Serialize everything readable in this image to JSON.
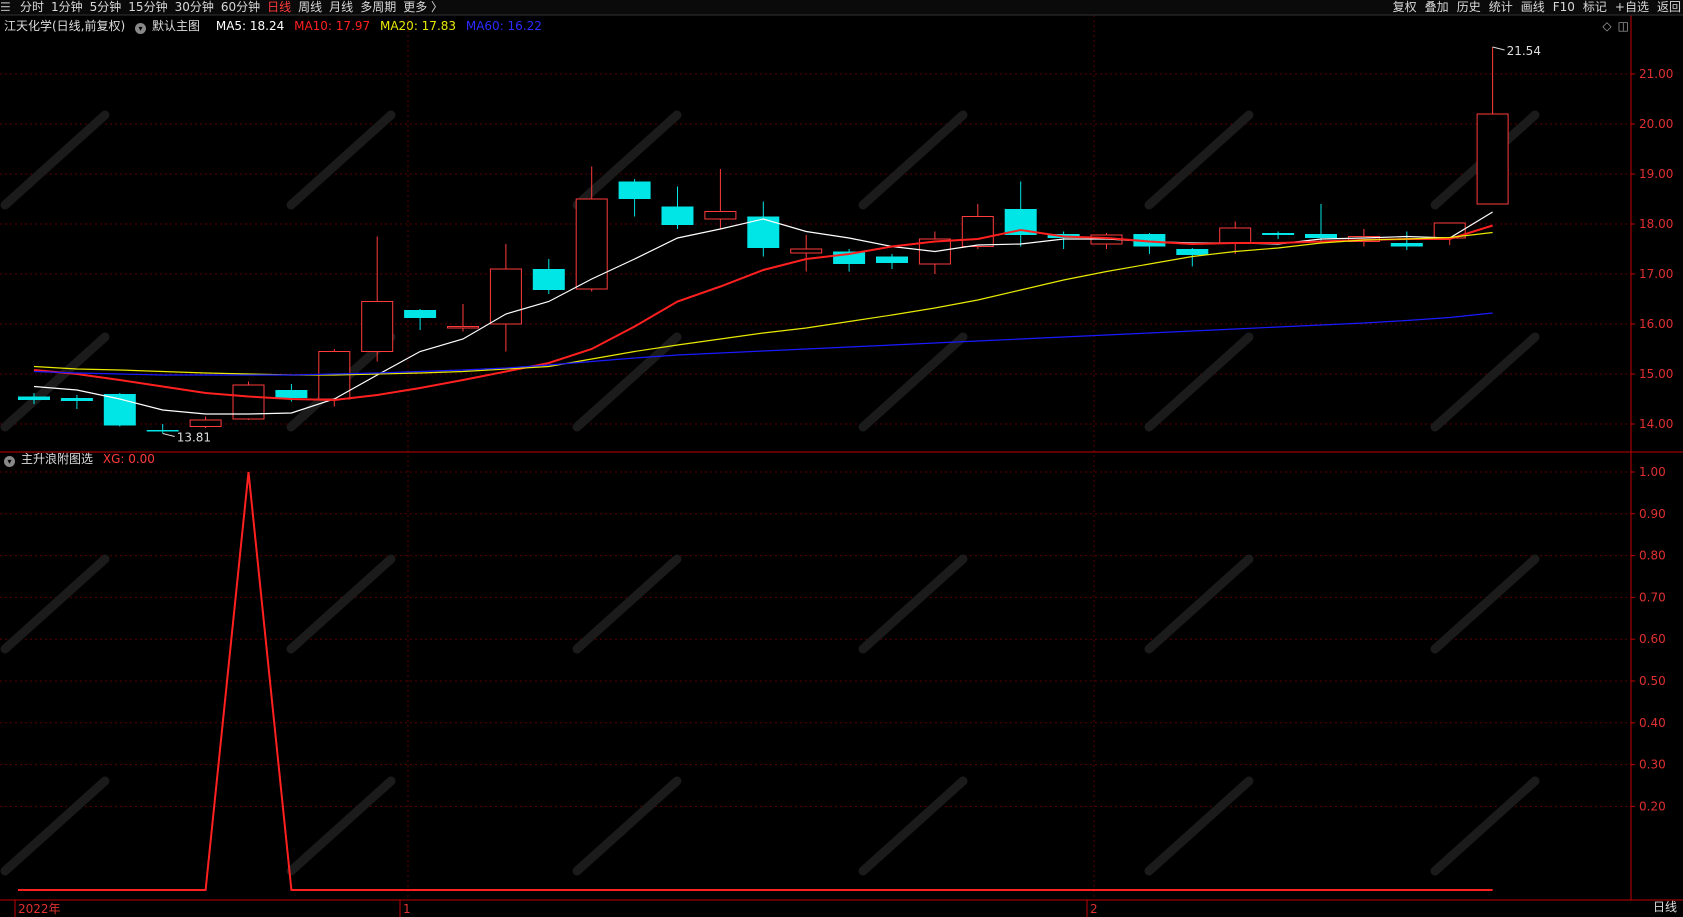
{
  "toolbar": {
    "left_items": [
      "分时",
      "1分钟",
      "5分钟",
      "15分钟",
      "30分钟",
      "60分钟",
      "日线",
      "周线",
      "月线",
      "多周期",
      "更多 〉"
    ],
    "active": "日线",
    "right_items": [
      "复权",
      "叠加",
      "历史",
      "统计",
      "画线",
      "F10",
      "标记",
      "+自选",
      "返回"
    ]
  },
  "main_legend": {
    "title": "江天化学(日线,前复权)",
    "indicator": "默认主图",
    "ma5": "MA5: 18.24",
    "ma10": "MA10: 17.97",
    "ma20": "MA20: 17.83",
    "ma60": "MA60: 16.22"
  },
  "sub_legend": {
    "indicator": "主升浪附图选",
    "xg": "XG: 0.00"
  },
  "bottom": {
    "period_label": "日线",
    "date_labels": [
      "2022年",
      "1",
      "2"
    ]
  },
  "colors": {
    "up": "#ff3b3b",
    "down": "#00e5e5",
    "ma5": "#ffffff",
    "ma10": "#ff2020",
    "ma20": "#e8e800",
    "ma60": "#1a1aff",
    "grid": "#5a0000",
    "axis": "#c00000"
  },
  "chart_data": [
    {
      "type": "candlestick",
      "title": "江天化学(日线,前复权)",
      "ylim": [
        13.5,
        21.8
      ],
      "yticks": [
        14.0,
        15.0,
        16.0,
        17.0,
        18.0,
        19.0,
        20.0,
        21.0
      ],
      "annotations": [
        {
          "label": "13.81"
        },
        {
          "label": "21.54"
        }
      ],
      "candles": [
        {
          "o": 14.55,
          "h": 14.62,
          "l": 14.4,
          "c": 14.48
        },
        {
          "o": 14.52,
          "h": 14.58,
          "l": 14.3,
          "c": 14.46
        },
        {
          "o": 14.6,
          "h": 14.62,
          "l": 13.95,
          "c": 13.97
        },
        {
          "o": 13.88,
          "h": 14.0,
          "l": 13.81,
          "c": 13.86
        },
        {
          "o": 13.95,
          "h": 14.15,
          "l": 13.92,
          "c": 14.08
        },
        {
          "o": 14.1,
          "h": 14.85,
          "l": 14.08,
          "c": 14.78
        },
        {
          "o": 14.68,
          "h": 14.8,
          "l": 14.45,
          "c": 14.52
        },
        {
          "o": 14.5,
          "h": 15.5,
          "l": 14.35,
          "c": 15.45
        },
        {
          "o": 15.45,
          "h": 17.75,
          "l": 15.25,
          "c": 16.45
        },
        {
          "o": 16.28,
          "h": 16.3,
          "l": 15.88,
          "c": 16.12
        },
        {
          "o": 15.92,
          "h": 16.4,
          "l": 15.85,
          "c": 15.95
        },
        {
          "o": 16.0,
          "h": 17.6,
          "l": 15.45,
          "c": 17.1
        },
        {
          "o": 17.1,
          "h": 17.3,
          "l": 16.6,
          "c": 16.68
        },
        {
          "o": 16.7,
          "h": 19.15,
          "l": 16.65,
          "c": 18.5
        },
        {
          "o": 18.85,
          "h": 18.9,
          "l": 18.15,
          "c": 18.5
        },
        {
          "o": 18.35,
          "h": 18.75,
          "l": 17.9,
          "c": 17.98
        },
        {
          "o": 18.1,
          "h": 19.1,
          "l": 17.9,
          "c": 18.25
        },
        {
          "o": 18.15,
          "h": 18.45,
          "l": 17.35,
          "c": 17.52
        },
        {
          "o": 17.42,
          "h": 17.78,
          "l": 17.05,
          "c": 17.5
        },
        {
          "o": 17.45,
          "h": 17.5,
          "l": 17.05,
          "c": 17.2
        },
        {
          "o": 17.35,
          "h": 17.4,
          "l": 17.1,
          "c": 17.22
        },
        {
          "o": 17.2,
          "h": 17.85,
          "l": 17.0,
          "c": 17.7
        },
        {
          "o": 17.55,
          "h": 18.4,
          "l": 17.5,
          "c": 18.15
        },
        {
          "o": 18.3,
          "h": 18.85,
          "l": 17.55,
          "c": 17.78
        },
        {
          "o": 17.8,
          "h": 17.85,
          "l": 17.5,
          "c": 17.72
        },
        {
          "o": 17.6,
          "h": 17.82,
          "l": 17.5,
          "c": 17.78
        },
        {
          "o": 17.8,
          "h": 17.82,
          "l": 17.4,
          "c": 17.55
        },
        {
          "o": 17.5,
          "h": 17.52,
          "l": 17.15,
          "c": 17.38
        },
        {
          "o": 17.62,
          "h": 18.05,
          "l": 17.4,
          "c": 17.92
        },
        {
          "o": 17.82,
          "h": 17.85,
          "l": 17.7,
          "c": 17.78
        },
        {
          "o": 17.8,
          "h": 18.4,
          "l": 17.65,
          "c": 17.72
        },
        {
          "o": 17.65,
          "h": 17.9,
          "l": 17.55,
          "c": 17.75
        },
        {
          "o": 17.62,
          "h": 17.85,
          "l": 17.48,
          "c": 17.55
        },
        {
          "o": 17.72,
          "h": 17.9,
          "l": 17.58,
          "c": 18.02
        },
        {
          "o": 18.4,
          "h": 21.54,
          "l": 18.4,
          "c": 20.2
        }
      ],
      "series": [
        {
          "name": "MA5",
          "values": [
            14.75,
            14.68,
            14.5,
            14.28,
            14.2,
            14.2,
            14.22,
            14.5,
            14.98,
            15.45,
            15.7,
            16.2,
            16.45,
            16.9,
            17.3,
            17.72,
            17.9,
            18.1,
            17.85,
            17.72,
            17.55,
            17.45,
            17.58,
            17.6,
            17.7,
            17.7,
            17.65,
            17.62,
            17.62,
            17.6,
            17.7,
            17.72,
            17.75,
            17.72,
            18.24
          ]
        },
        {
          "name": "MA10",
          "values": [
            15.08,
            15.0,
            14.88,
            14.75,
            14.62,
            14.55,
            14.5,
            14.48,
            14.58,
            14.72,
            14.88,
            15.05,
            15.22,
            15.5,
            15.95,
            16.45,
            16.75,
            17.08,
            17.3,
            17.4,
            17.55,
            17.65,
            17.7,
            17.88,
            17.75,
            17.72,
            17.65,
            17.6,
            17.62,
            17.62,
            17.65,
            17.68,
            17.7,
            17.7,
            17.97
          ]
        },
        {
          "name": "MA20",
          "values": [
            15.15,
            15.1,
            15.08,
            15.05,
            15.02,
            15.0,
            14.98,
            14.98,
            15.0,
            15.02,
            15.05,
            15.1,
            15.15,
            15.3,
            15.45,
            15.58,
            15.7,
            15.82,
            15.92,
            16.05,
            16.18,
            16.32,
            16.48,
            16.68,
            16.88,
            17.05,
            17.2,
            17.35,
            17.45,
            17.52,
            17.62,
            17.68,
            17.7,
            17.73,
            17.83
          ]
        },
        {
          "name": "MA60",
          "values": [
            15.05,
            15.02,
            15.0,
            14.98,
            14.98,
            14.98,
            14.98,
            15.0,
            15.02,
            15.05,
            15.08,
            15.12,
            15.18,
            15.25,
            15.32,
            15.38,
            15.42,
            15.46,
            15.5,
            15.54,
            15.58,
            15.62,
            15.66,
            15.7,
            15.74,
            15.78,
            15.82,
            15.86,
            15.9,
            15.94,
            15.98,
            16.02,
            16.07,
            16.13,
            16.22
          ]
        }
      ]
    },
    {
      "type": "line",
      "title": "主升浪附图选",
      "ylim": [
        0.0,
        1.05
      ],
      "yticks": [
        0.2,
        0.3,
        0.4,
        0.5,
        0.6,
        0.7,
        0.8,
        0.9,
        1.0
      ],
      "series": [
        {
          "name": "XG",
          "values": [
            0,
            0,
            0,
            0,
            0,
            1,
            0,
            0,
            0,
            0,
            0,
            0,
            0,
            0,
            0,
            0,
            0,
            0,
            0,
            0,
            0,
            0,
            0,
            0,
            0,
            0,
            0,
            0,
            0,
            0,
            0,
            0,
            0,
            0,
            0
          ]
        }
      ]
    }
  ]
}
